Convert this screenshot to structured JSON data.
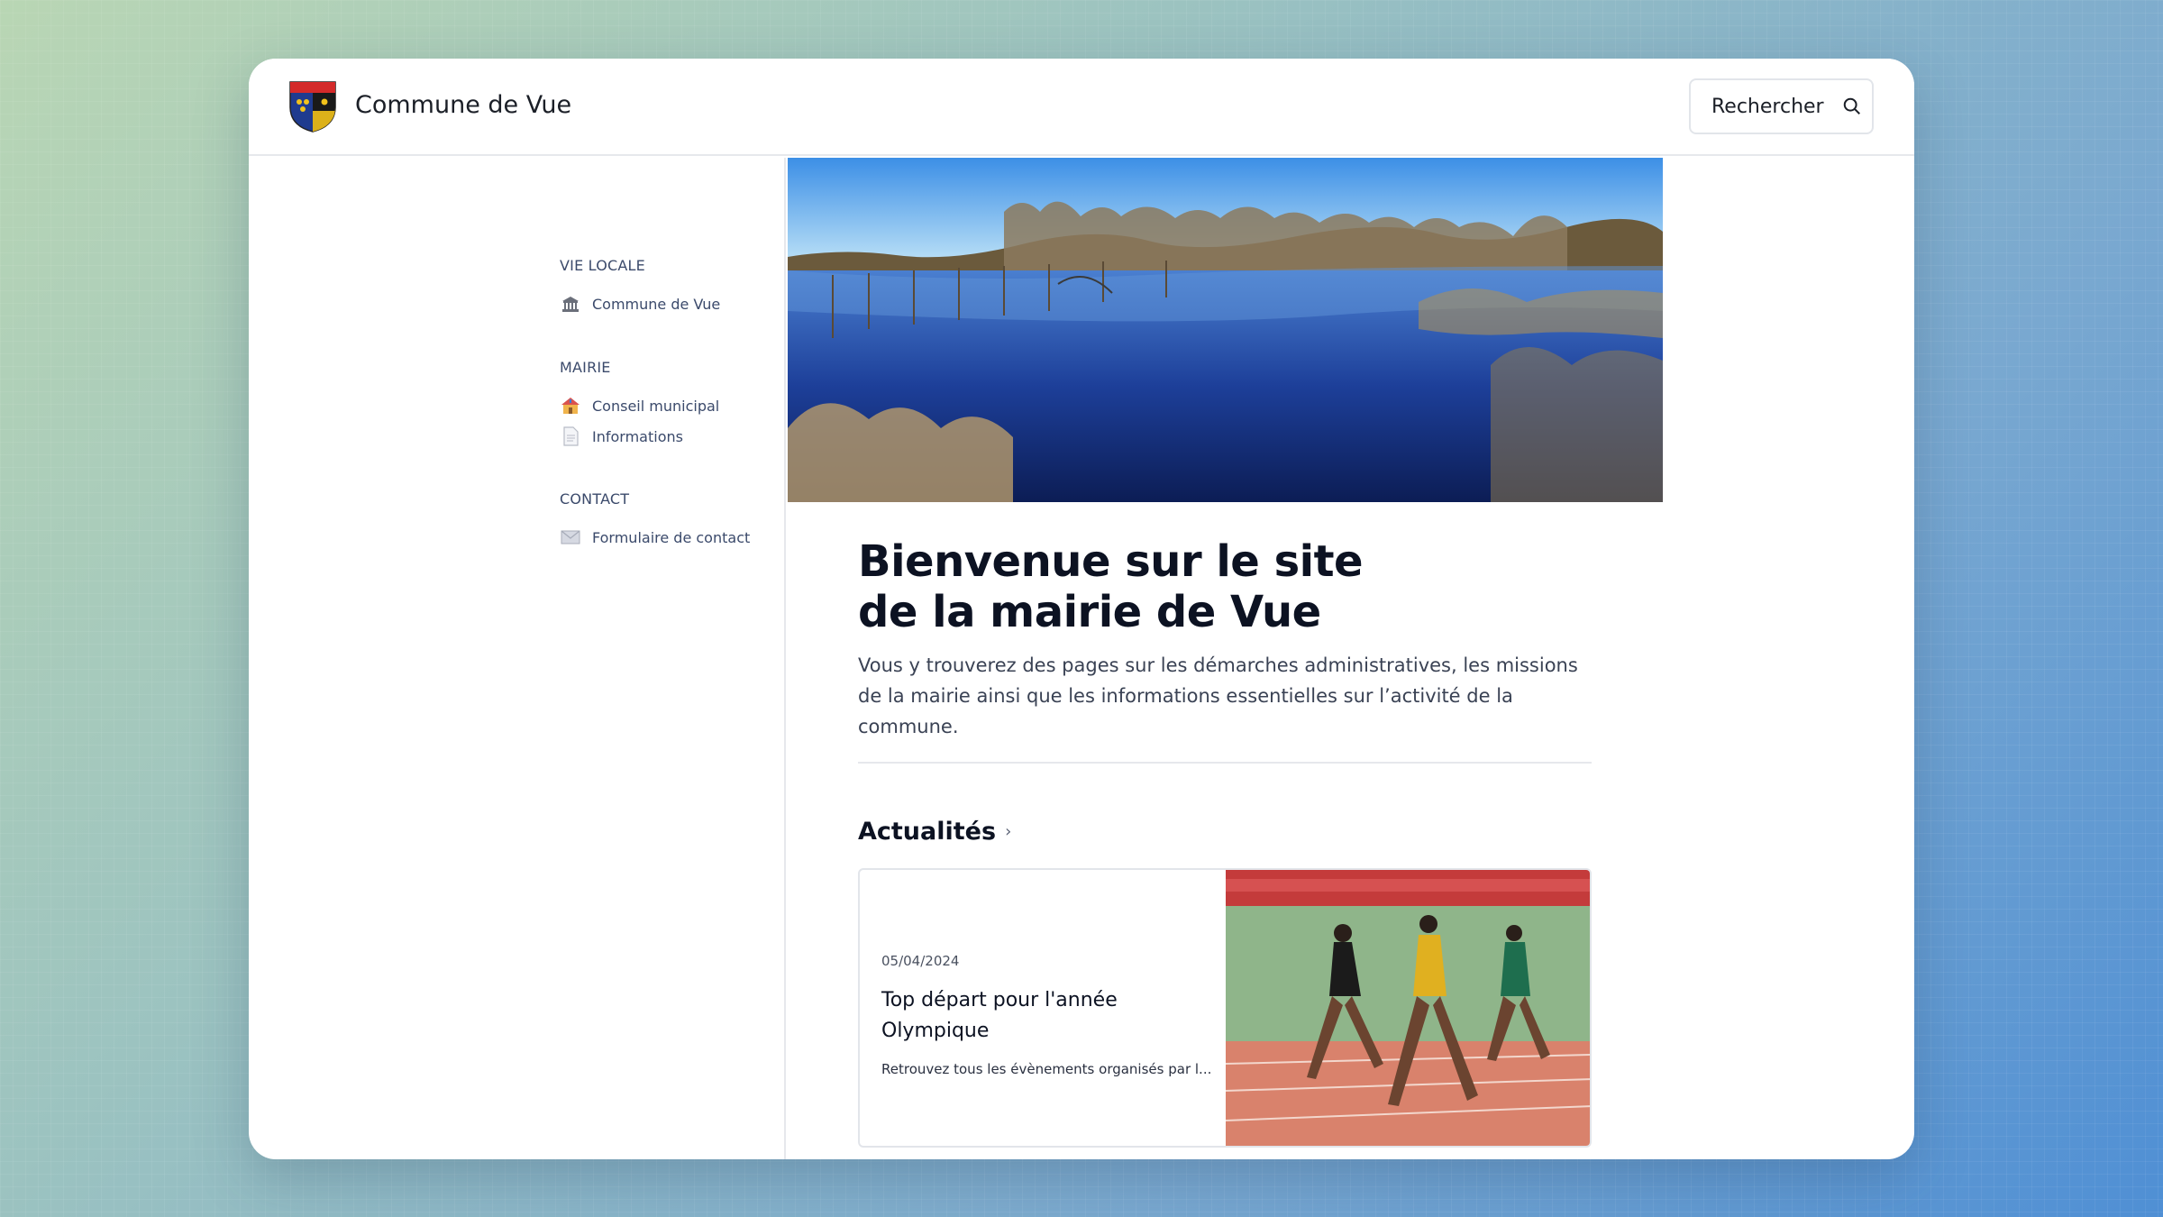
{
  "header": {
    "site_title": "Commune de Vue",
    "search_label": "Rechercher",
    "logo_icon": "coat-of-arms-icon",
    "search_icon": "search-icon"
  },
  "sidebar": {
    "groups": [
      {
        "heading": "VIE LOCALE",
        "items": [
          {
            "label": "Commune de Vue",
            "icon": "building-icon"
          }
        ]
      },
      {
        "heading": "MAIRIE",
        "items": [
          {
            "label": "Conseil municipal",
            "icon": "house-icon"
          },
          {
            "label": "Informations",
            "icon": "document-icon"
          }
        ]
      },
      {
        "heading": "CONTACT",
        "items": [
          {
            "label": "Formulaire de contact",
            "icon": "envelope-icon"
          }
        ]
      }
    ]
  },
  "main": {
    "headline_line1": "Bienvenue sur le site",
    "headline_line2": "de la mairie de Vue",
    "intro": "Vous y trouverez des pages sur les démarches administratives, les missions de la mairie ainsi que les informations essentielles sur l’activité de la commune.",
    "news_heading": "Actualités",
    "news": [
      {
        "date": "05/04/2024",
        "title": "Top départ pour l'année Olympique",
        "excerpt": "Retrouvez tous les évènements organisés par l..."
      }
    ]
  },
  "colors": {
    "text_dark": "#0c1222",
    "nav_text": "#3b4a6b",
    "border": "#e6e8ec"
  }
}
